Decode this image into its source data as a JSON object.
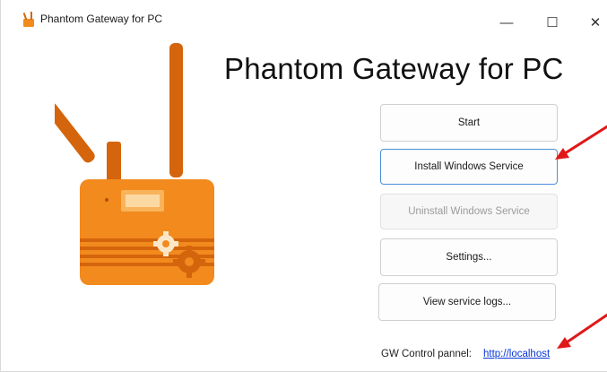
{
  "window": {
    "title": "Phantom Gateway for PC",
    "minimize_glyph": "—",
    "maximize_glyph": "☐",
    "close_glyph": "✕"
  },
  "main": {
    "heading": "Phantom Gateway for PC",
    "buttons": {
      "start": "Start",
      "install": "Install Windows Service",
      "uninstall": "Uninstall Windows Service",
      "settings": "Settings...",
      "view_logs": "View service logs..."
    },
    "control_panel_label": "GW Control pannel:",
    "control_panel_link": "http://localhost"
  },
  "colors": {
    "device_orange": "#f28a1e",
    "device_dark": "#d4650c",
    "arrow_red": "#e01818",
    "link_blue": "#0a36d8"
  },
  "icons": [
    "app-logo-icon",
    "minimize-icon",
    "maximize-icon",
    "close-icon",
    "gateway-device-illustration",
    "red-arrow-annotation"
  ]
}
